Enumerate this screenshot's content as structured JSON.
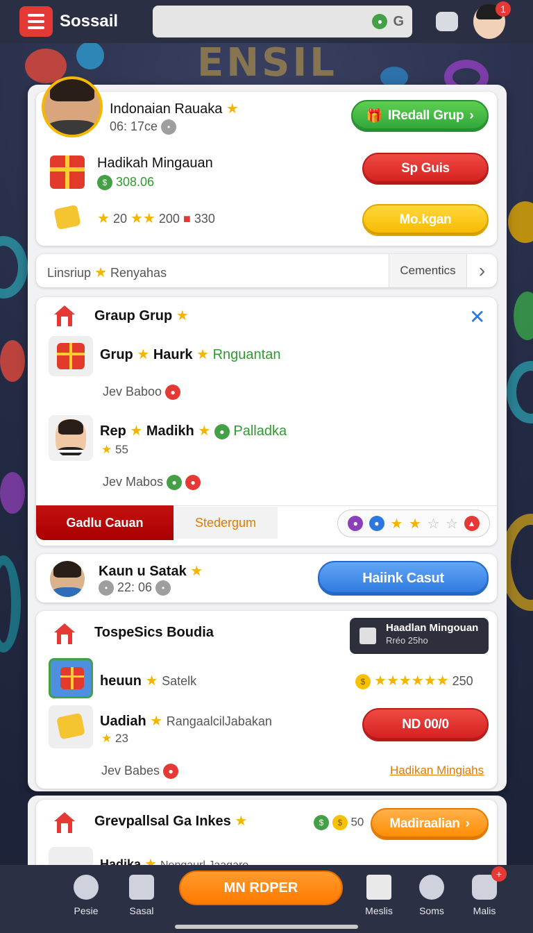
{
  "app": {
    "brand": "Sossail"
  },
  "header": {
    "search_placeholder": "",
    "search_right_glyph": "G",
    "icons": [
      "menu-icon",
      "microphone-icon",
      "chat-icon",
      "avatar"
    ],
    "notification_count": "1"
  },
  "banner_text": "ENSIL",
  "profile_card": {
    "name": "Indonaian Rauaka",
    "time": "06: 17ce",
    "recall_button": "IRedall Grup",
    "reward_title": "Hadikah Mingauan",
    "reward_value": "308.06",
    "spin_button": "Sp Guis",
    "stats": {
      "a": "20",
      "b": "200",
      "c": "330"
    },
    "claim_button": "Mo.kgan"
  },
  "tabs_row": {
    "left": "Linsriup",
    "middle": "Renyahas",
    "right_tab": "Cementics"
  },
  "group_card": {
    "title": "Graup Grup",
    "row1": {
      "a": "Grup",
      "b": "Haurk",
      "c": "Rnguantan",
      "sub": "Jev Baboo"
    },
    "row2": {
      "a": "Rep",
      "b": "Madikh",
      "c": "Palladka",
      "stars": "55",
      "sub": "Jev Mabos"
    },
    "tab_active": "Gadlu Cauan",
    "tab_inactive": "Stedergum"
  },
  "user_card": {
    "name": "Kaun u Satak",
    "time": "22: 06",
    "button": "Haiink Casut"
  },
  "topspec_card": {
    "title": "TospeSics Boudia",
    "tag_title": "Haadlan Mingouan",
    "tag_sub": "Rréo 25ho",
    "row1": {
      "label": "heuun",
      "sub": "Satelk",
      "value": "250"
    },
    "row2": {
      "label": "Uadiah",
      "sub": "RangaalcilJabakan",
      "stars": "23",
      "button": "ND 00/0"
    },
    "footer_left": "Jev Babes",
    "footer_link": "Hadikan Mingiahs"
  },
  "group2_card": {
    "title": "Grevpallsal Ga Inkes",
    "count": "50",
    "button": "Madiraalian",
    "row_partial": "Hadika",
    "row_partial_sub": "Nengaurl Jaagare"
  },
  "bottom_nav": {
    "items": [
      "Pesie",
      "Sasal",
      "Meslis",
      "Soms",
      "Malis"
    ],
    "center": "MN RDPER",
    "badge": "+"
  },
  "colors": {
    "accent_red": "#e53935",
    "accent_green": "#2ea43a",
    "accent_blue": "#2d78e0",
    "accent_orange": "#ff8a00",
    "accent_yellow": "#f7b800"
  }
}
